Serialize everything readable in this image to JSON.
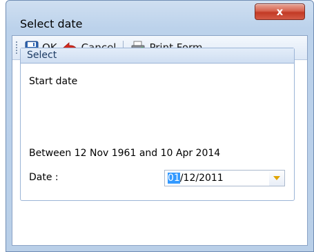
{
  "window": {
    "title": "Select date",
    "close_glyph": "x"
  },
  "toolbar": {
    "ok_label": "OK",
    "cancel_label": "Cancel",
    "print_label": "Print Form"
  },
  "group": {
    "header": "Select",
    "field_name": "Start date",
    "range_text": "Between 12 Nov 1961 and 10 Apr 2014",
    "date_label": "Date :",
    "date_selected_part": "01",
    "date_rest": "/12/2011"
  },
  "icons": {
    "ok": "floppy-disk-icon",
    "cancel": "red-arrow-left-icon",
    "print": "printer-form-icon",
    "dropdown": "chevron-down-icon"
  },
  "colors": {
    "selection": "#3399ff",
    "close_button": "#c23a25",
    "dropdown_arrow": "#e0a400"
  }
}
